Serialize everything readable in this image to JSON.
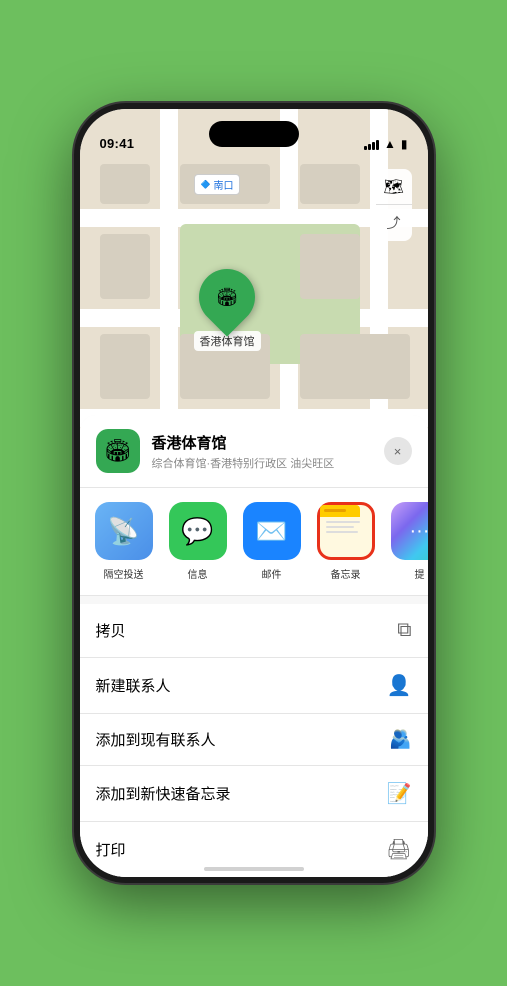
{
  "status_bar": {
    "time": "09:41",
    "signal_label": "signal",
    "wifi_label": "wifi",
    "battery_label": "battery"
  },
  "map": {
    "label_tag": "南口",
    "pin_label": "香港体育馆",
    "controls": {
      "map_icon": "🗺",
      "location_icon": "➤"
    }
  },
  "venue_card": {
    "name": "香港体育馆",
    "subtitle": "综合体育馆·香港特别行政区 油尖旺区",
    "close_label": "×"
  },
  "share_actions": [
    {
      "id": "airdrop",
      "label": "隔空投送",
      "emoji": "📡"
    },
    {
      "id": "message",
      "label": "信息",
      "emoji": "💬"
    },
    {
      "id": "mail",
      "label": "邮件",
      "emoji": "✉"
    },
    {
      "id": "notes",
      "label": "备忘录",
      "emoji": ""
    },
    {
      "id": "more",
      "label": "提",
      "emoji": "⋯"
    }
  ],
  "action_items": [
    {
      "label": "拷贝",
      "icon": "📋"
    },
    {
      "label": "新建联系人",
      "icon": "👤"
    },
    {
      "label": "添加到现有联系人",
      "icon": "👤"
    },
    {
      "label": "添加到新快速备忘录",
      "icon": "📝"
    },
    {
      "label": "打印",
      "icon": "🖨"
    }
  ]
}
